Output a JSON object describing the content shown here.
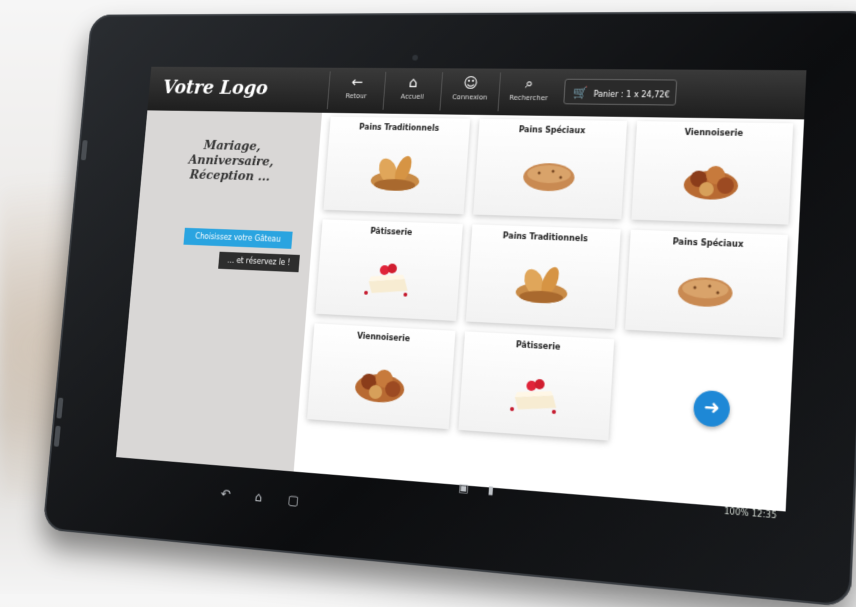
{
  "app": {
    "logo": "Votre Logo",
    "nav": [
      {
        "label": "Retour",
        "icon": "back-arrow-icon",
        "glyph": "←"
      },
      {
        "label": "Accueil",
        "icon": "home-icon",
        "glyph": "⌂"
      },
      {
        "label": "Connexion",
        "icon": "user-check-icon",
        "glyph": "☺"
      },
      {
        "label": "Rechercher",
        "icon": "search-icon",
        "glyph": "⌕"
      }
    ],
    "cart": {
      "label": "Panier : 1 x 24,72€",
      "icon": "cart-icon"
    }
  },
  "left": {
    "tagline_line1": "Mariage, Anniversaire,",
    "tagline_line2": "Réception ...",
    "choose_button": "Choisissez votre Gâteau",
    "reserve_button": "... et réservez le !"
  },
  "products": [
    {
      "title": "Pains Traditionnels",
      "image": "bread-basket"
    },
    {
      "title": "Pains Spéciaux",
      "image": "special-bread"
    },
    {
      "title": "Viennoiserie",
      "image": "viennoiserie"
    },
    {
      "title": "Pâtisserie",
      "image": "pastry-cake"
    },
    {
      "title": "Pains Traditionnels",
      "image": "bread-basket"
    },
    {
      "title": "Pains Spéciaux",
      "image": "special-bread"
    },
    {
      "title": "Viennoiserie",
      "image": "viennoiserie"
    },
    {
      "title": "Pâtisserie",
      "image": "pastry-cake"
    }
  ],
  "next_button_icon": "next-arrow-icon",
  "status": {
    "text": "100% 12:35"
  },
  "colors": {
    "accent": "#2aa4e0",
    "appbar": "#1e1e1e",
    "panel": "#d9d7d6"
  }
}
